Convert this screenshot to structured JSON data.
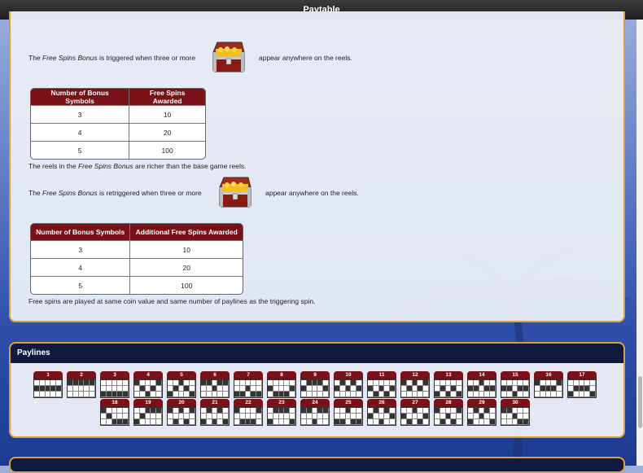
{
  "window": {
    "title": "Paytable"
  },
  "bonus": {
    "trigger_pre": "The ",
    "trigger_em": "Free Spins Bonus",
    "trigger_mid": " is triggered when three or more",
    "trigger_post": "appear anywhere on the reels.",
    "table1": {
      "headers": [
        "Number of Bonus Symbols",
        "Free Spins Awarded"
      ],
      "rows": [
        [
          "3",
          "10"
        ],
        [
          "4",
          "20"
        ],
        [
          "5",
          "100"
        ]
      ]
    },
    "richer_pre": "The reels in the ",
    "richer_em": "Free Spins Bonus",
    "richer_post": " are richer than the base game reels.",
    "retrigger_pre": "The ",
    "retrigger_em": "Free Spins Bonus",
    "retrigger_mid": " is retriggered when three or more",
    "retrigger_post": "appear anywhere on the reels.",
    "table2": {
      "headers": [
        "Number of Bonus Symbols",
        "Additional Free Spins Awarded"
      ],
      "rows": [
        [
          "3",
          "10"
        ],
        [
          "4",
          "20"
        ],
        [
          "5",
          "100"
        ]
      ]
    },
    "footer": "Free spins are played at same coin value and same number of paylines as the triggering spin."
  },
  "paylines": {
    "title": "Paylines",
    "lines": [
      {
        "n": "1",
        "rows": [
          1,
          1,
          1,
          1,
          1
        ]
      },
      {
        "n": "2",
        "rows": [
          0,
          0,
          0,
          0,
          0
        ]
      },
      {
        "n": "3",
        "rows": [
          2,
          2,
          2,
          2,
          2
        ]
      },
      {
        "n": "4",
        "rows": [
          0,
          1,
          2,
          1,
          0
        ]
      },
      {
        "n": "5",
        "rows": [
          2,
          1,
          0,
          1,
          2
        ]
      },
      {
        "n": "6",
        "rows": [
          0,
          0,
          1,
          0,
          0
        ]
      },
      {
        "n": "7",
        "rows": [
          2,
          2,
          1,
          2,
          2
        ]
      },
      {
        "n": "8",
        "rows": [
          1,
          2,
          2,
          2,
          1
        ]
      },
      {
        "n": "9",
        "rows": [
          1,
          0,
          0,
          0,
          1
        ]
      },
      {
        "n": "10",
        "rows": [
          1,
          0,
          1,
          0,
          1
        ]
      },
      {
        "n": "11",
        "rows": [
          1,
          2,
          1,
          2,
          1
        ]
      },
      {
        "n": "12",
        "rows": [
          0,
          1,
          0,
          1,
          0
        ]
      },
      {
        "n": "13",
        "rows": [
          2,
          1,
          2,
          1,
          2
        ]
      },
      {
        "n": "14",
        "rows": [
          1,
          1,
          0,
          1,
          1
        ]
      },
      {
        "n": "15",
        "rows": [
          1,
          1,
          2,
          1,
          1
        ]
      },
      {
        "n": "16",
        "rows": [
          0,
          1,
          1,
          1,
          0
        ]
      },
      {
        "n": "17",
        "rows": [
          2,
          1,
          1,
          1,
          2
        ]
      },
      {
        "n": "18",
        "rows": [
          0,
          1,
          2,
          2,
          2
        ]
      },
      {
        "n": "19",
        "rows": [
          2,
          1,
          0,
          0,
          0
        ]
      },
      {
        "n": "20",
        "rows": [
          0,
          2,
          0,
          2,
          0
        ]
      },
      {
        "n": "21",
        "rows": [
          2,
          0,
          2,
          0,
          2
        ]
      },
      {
        "n": "22",
        "rows": [
          0,
          2,
          2,
          2,
          0
        ]
      },
      {
        "n": "23",
        "rows": [
          2,
          0,
          0,
          0,
          2
        ]
      },
      {
        "n": "24",
        "rows": [
          0,
          0,
          2,
          0,
          0
        ]
      },
      {
        "n": "25",
        "rows": [
          2,
          2,
          0,
          2,
          2
        ]
      },
      {
        "n": "26",
        "rows": [
          1,
          0,
          2,
          0,
          1
        ]
      },
      {
        "n": "27",
        "rows": [
          1,
          2,
          0,
          2,
          1
        ]
      },
      {
        "n": "28",
        "rows": [
          0,
          2,
          1,
          2,
          0
        ]
      },
      {
        "n": "29",
        "rows": [
          2,
          0,
          1,
          0,
          2
        ]
      },
      {
        "n": "30",
        "rows": [
          0,
          0,
          1,
          2,
          2
        ]
      }
    ]
  },
  "colors": {
    "accent": "#7a1018",
    "frame": "#d9a13a",
    "header": "#0f1a3e"
  },
  "icons": {
    "bonus_symbol": "treasure-chest-icon"
  }
}
